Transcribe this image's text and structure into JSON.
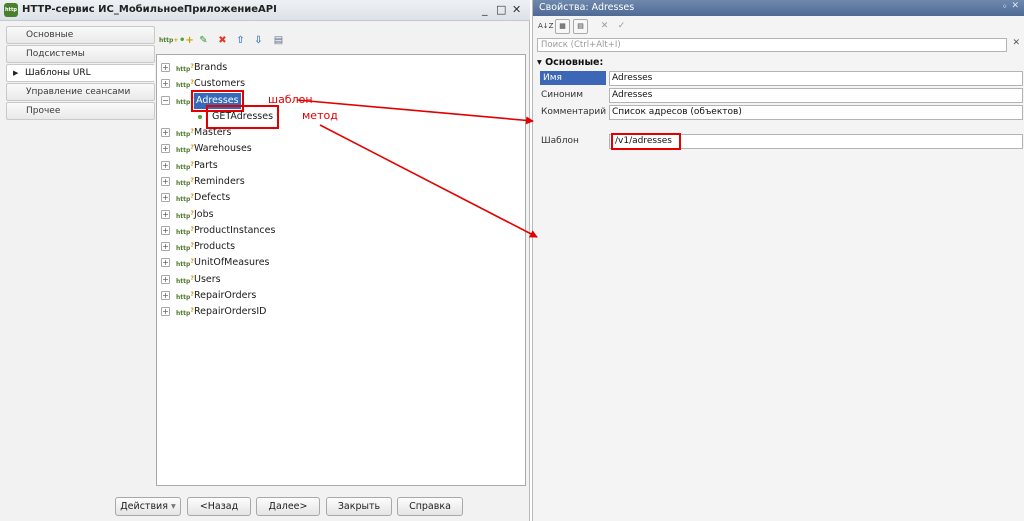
{
  "window": {
    "title": "HTTP-сервис ИС_МобильноеПриложениеAPI",
    "icon": "http-service-icon",
    "minimize": "_",
    "maximize": "□",
    "close": "✕"
  },
  "nav": {
    "items": [
      {
        "label": "Основные"
      },
      {
        "label": "Подсистемы"
      },
      {
        "label": "Шаблоны URL",
        "active": true
      },
      {
        "label": "Управление сеансами"
      },
      {
        "label": "Прочее"
      }
    ],
    "active_marker": "▶"
  },
  "toolbar": {
    "icons": [
      "add-url-template-icon",
      "add-method-icon",
      "edit-icon",
      "delete-icon",
      "move-up-icon",
      "move-down-icon",
      "list-icon"
    ]
  },
  "tree": {
    "icon_text": "http",
    "expand": "+",
    "collapse": "−",
    "nodes": [
      {
        "label": "Brands"
      },
      {
        "label": "Customers"
      },
      {
        "label": "Adresses",
        "expanded": true,
        "selected": true
      },
      {
        "label": "GETAdresses",
        "child": true
      },
      {
        "label": "Masters"
      },
      {
        "label": "Warehouses"
      },
      {
        "label": "Parts"
      },
      {
        "label": "Reminders"
      },
      {
        "label": "Defects"
      },
      {
        "label": "Jobs"
      },
      {
        "label": "ProductInstances"
      },
      {
        "label": "Products"
      },
      {
        "label": "UnitOfMeasures"
      },
      {
        "label": "Users"
      },
      {
        "label": "RepairOrders"
      },
      {
        "label": "RepairOrdersID"
      }
    ]
  },
  "annotations": {
    "template": "шаблон",
    "method": "метод"
  },
  "buttons": {
    "actions": "Действия",
    "actions_arrow": "▾",
    "back": "<Назад",
    "next": "Далее>",
    "close": "Закрыть",
    "help": "Справка"
  },
  "props": {
    "title": "Свойства: Adresses",
    "pin": "ᛜ",
    "close": "✕",
    "toolbar": {
      "sort": "A↓Z",
      "cat1": "▦",
      "cat2": "▤",
      "cancel": "✕",
      "ok": "✓"
    },
    "search_placeholder": "Поиск (Ctrl+Alt+I)",
    "search_clear": "✕",
    "group": "Основные:",
    "group_marker": "▾",
    "fields": [
      {
        "label": "Имя",
        "value": "Adresses",
        "highlighted": true
      },
      {
        "label": "Синоним",
        "value": "Adresses"
      },
      {
        "label": "Комментарий",
        "value": "Список адресов (объектов)"
      }
    ],
    "template_field": {
      "label": "Шаблон",
      "value": "/v1/adresses"
    }
  },
  "colors": {
    "annotation": "#e30000",
    "selection": "#3669b9",
    "props_header": "#5a76a0"
  }
}
